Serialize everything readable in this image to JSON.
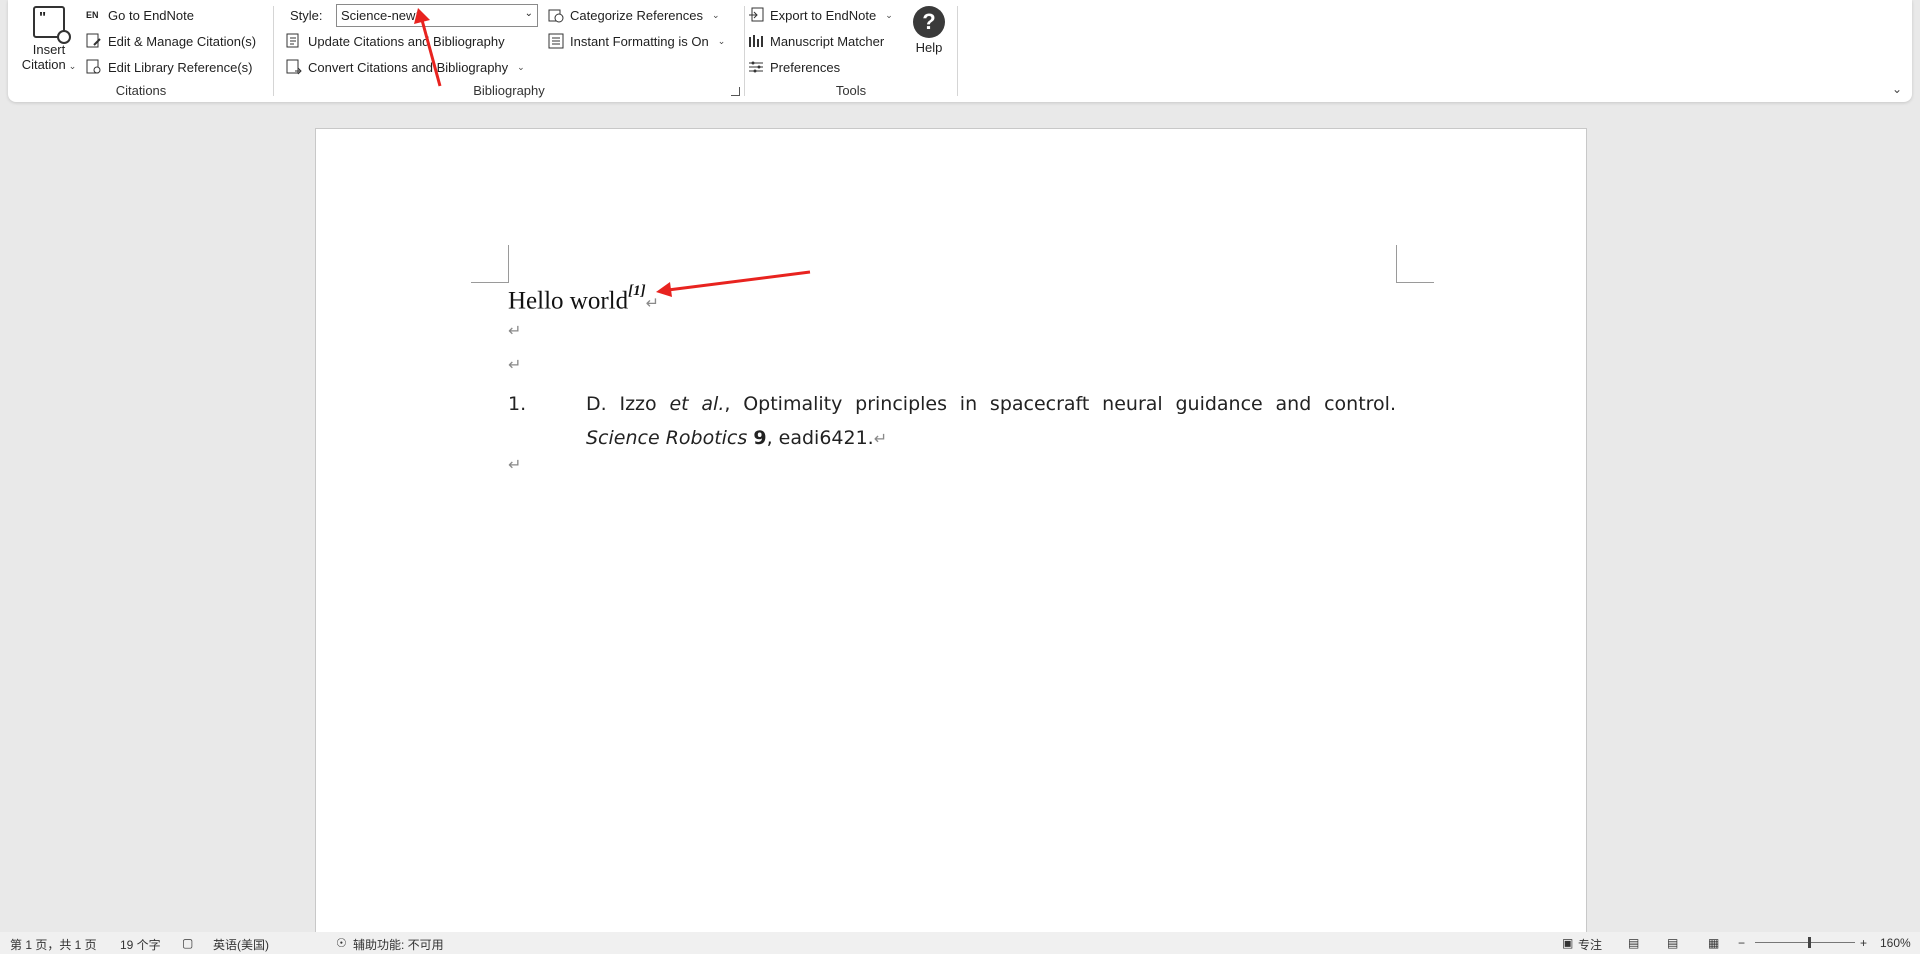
{
  "ribbon": {
    "citations": {
      "insert_citation_line1": "Insert",
      "insert_citation_line2": "Citation",
      "go_to_endnote": "Go to EndNote",
      "go_to_endnote_badge": "EN",
      "edit_manage": "Edit & Manage Citation(s)",
      "edit_library": "Edit Library Reference(s)",
      "label": "Citations"
    },
    "bibliography": {
      "style_label": "Style:",
      "style_value": "Science-new1",
      "update": "Update Citations and Bibliography",
      "convert": "Convert Citations and Bibliography",
      "categorize": "Categorize References",
      "instant_formatting": "Instant Formatting is On",
      "label": "Bibliography"
    },
    "tools": {
      "export": "Export to EndNote",
      "manuscript_matcher": "Manuscript Matcher",
      "preferences": "Preferences",
      "label": "Tools"
    },
    "help_label": "Help",
    "help_icon": "?"
  },
  "document": {
    "hello_text": "Hello world",
    "citation_mark": "[1]",
    "para_mark": "↵",
    "ref_number": "1.",
    "ref_authors": "D. Izzo ",
    "ref_etal": "et al.",
    "ref_title": ", Optimality principles in spacecraft neural guidance and control. ",
    "ref_journal": "Science Robotics",
    "ref_sep": " ",
    "ref_volume": "9",
    "ref_pages": ", eadi6421."
  },
  "status_bar": {
    "page": "第 1 页，共 1 页",
    "words": "19 个字",
    "language": "英语(美国)",
    "accessibility": "辅助功能: 不可用",
    "focus": "专注",
    "zoom_minus": "−",
    "zoom_plus": "+",
    "zoom": "160%"
  },
  "colors": {
    "annotation_arrow": "#e8231f",
    "ribbon_bg": "#ffffff",
    "canvas_bg": "#e9e9e9"
  }
}
